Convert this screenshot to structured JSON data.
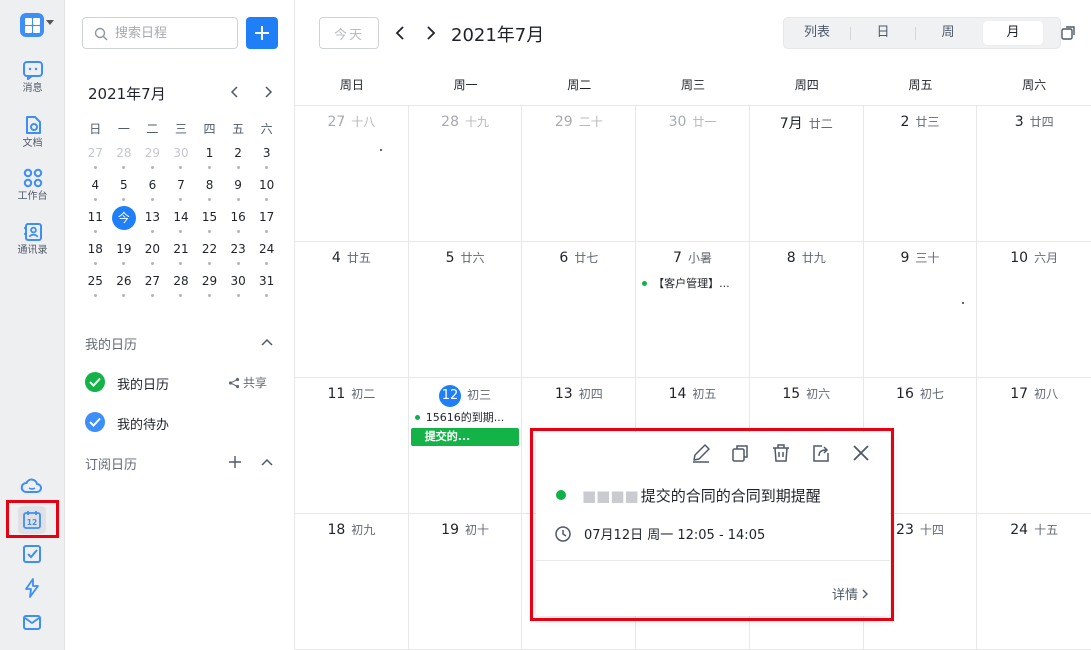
{
  "rail": {
    "items": [
      {
        "label": "消息",
        "icon": "message-icon"
      },
      {
        "label": "文档",
        "icon": "document-icon"
      },
      {
        "label": "工作台",
        "icon": "workbench-icon"
      },
      {
        "label": "通讯录",
        "icon": "contacts-icon"
      }
    ],
    "calendar_badge": "12"
  },
  "panel": {
    "search_placeholder": "搜索日程",
    "mini_title": "2021年7月",
    "weekdays": [
      "日",
      "一",
      "二",
      "三",
      "四",
      "五",
      "六"
    ],
    "weeks": [
      [
        {
          "d": "27",
          "m": true
        },
        {
          "d": "28",
          "m": true
        },
        {
          "d": "29",
          "m": true
        },
        {
          "d": "30",
          "m": true
        },
        {
          "d": "1"
        },
        {
          "d": "2"
        },
        {
          "d": "3"
        }
      ],
      [
        {
          "d": "4"
        },
        {
          "d": "5"
        },
        {
          "d": "6"
        },
        {
          "d": "7"
        },
        {
          "d": "8"
        },
        {
          "d": "9"
        },
        {
          "d": "10"
        }
      ],
      [
        {
          "d": "11"
        },
        {
          "d": "今",
          "today": true
        },
        {
          "d": "13"
        },
        {
          "d": "14"
        },
        {
          "d": "15"
        },
        {
          "d": "16"
        },
        {
          "d": "17"
        }
      ],
      [
        {
          "d": "18"
        },
        {
          "d": "19"
        },
        {
          "d": "20"
        },
        {
          "d": "21"
        },
        {
          "d": "22"
        },
        {
          "d": "23"
        },
        {
          "d": "24"
        }
      ],
      [
        {
          "d": "25"
        },
        {
          "d": "26"
        },
        {
          "d": "27"
        },
        {
          "d": "28"
        },
        {
          "d": "29"
        },
        {
          "d": "30"
        },
        {
          "d": "31"
        }
      ]
    ],
    "my_calendars_label": "我的日历",
    "my_calendar": "我的日历",
    "share_label": "共享",
    "my_todo": "我的待办",
    "subscribed_label": "订阅日历"
  },
  "main": {
    "today_label": "今天",
    "title": "2021年7月",
    "views": [
      "列表",
      "日",
      "周",
      "月"
    ],
    "active_view": "月",
    "weekdays": [
      "周日",
      "周一",
      "周二",
      "周三",
      "周四",
      "周五",
      "周六"
    ],
    "weeks": [
      [
        {
          "d": "27",
          "l": "十八",
          "m": true
        },
        {
          "d": "28",
          "l": "十九",
          "m": true
        },
        {
          "d": "29",
          "l": "二十",
          "m": true
        },
        {
          "d": "30",
          "l": "廿一",
          "m": true
        },
        {
          "d": "7月",
          "l": "廿二"
        },
        {
          "d": "2",
          "l": "廿三"
        },
        {
          "d": "3",
          "l": "廿四"
        }
      ],
      [
        {
          "d": "4",
          "l": "廿五"
        },
        {
          "d": "5",
          "l": "廿六"
        },
        {
          "d": "6",
          "l": "廿七"
        },
        {
          "d": "7",
          "l": "小暑"
        },
        {
          "d": "8",
          "l": "廿九"
        },
        {
          "d": "9",
          "l": "三十"
        },
        {
          "d": "10",
          "l": "六月"
        }
      ],
      [
        {
          "d": "11",
          "l": "初二"
        },
        {
          "d": "12",
          "l": "初三",
          "today": true
        },
        {
          "d": "13",
          "l": "初四"
        },
        {
          "d": "14",
          "l": "初五"
        },
        {
          "d": "15",
          "l": "初六"
        },
        {
          "d": "16",
          "l": "初七"
        },
        {
          "d": "17",
          "l": "初八"
        }
      ],
      [
        {
          "d": "18",
          "l": "初九"
        },
        {
          "d": "19",
          "l": "初十"
        },
        {
          "d": "",
          "l": ""
        },
        {
          "d": "",
          "l": ""
        },
        {
          "d": "",
          "l": ""
        },
        {
          "d": "23",
          "l": "十四"
        },
        {
          "d": "24",
          "l": "十五"
        }
      ]
    ],
    "events": {
      "jul7": "【客户管理】...",
      "jul12_a": "15616的到期...",
      "jul12_b": "提交的..."
    }
  },
  "popover": {
    "title": "提交的合同的合同到期提醒",
    "time": "07月12日 周一 12:05 - 14:05",
    "detail": "详情"
  },
  "colors": {
    "accent": "#1f7ff7",
    "event_green": "#10b04a",
    "highlight_red": "#e60012"
  }
}
